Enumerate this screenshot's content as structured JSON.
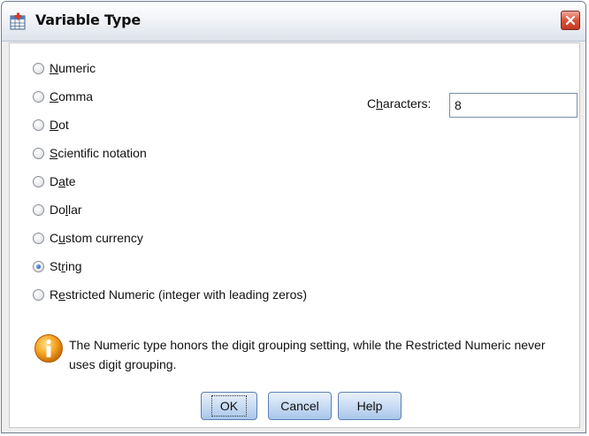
{
  "window": {
    "title": "Variable Type"
  },
  "format_options": [
    {
      "label_mn": "N",
      "label_rest": "umeric",
      "selected": false
    },
    {
      "label_mn": "C",
      "label_rest": "omma",
      "selected": false
    },
    {
      "label_mn": "D",
      "label_rest": "ot",
      "selected": false
    },
    {
      "label_mn": "S",
      "label_rest": "cientific notation",
      "selected": false
    },
    {
      "label_pre": "D",
      "label_mn": "a",
      "label_rest": "te",
      "selected": false
    },
    {
      "label_pre": "Do",
      "label_mn": "l",
      "label_rest": "lar",
      "selected": false
    },
    {
      "label_pre": "C",
      "label_mn": "u",
      "label_rest": "stom currency",
      "selected": false
    },
    {
      "label_pre": "St",
      "label_mn": "r",
      "label_rest": "ing",
      "selected": true
    },
    {
      "label_pre": "R",
      "label_mn": "e",
      "label_rest": "stricted Numeric (integer with leading zeros)",
      "selected": false
    }
  ],
  "characters": {
    "label_pre": "C",
    "label_mn": "h",
    "label_rest": "aracters:",
    "value": "8"
  },
  "info": {
    "icon": "info-icon",
    "text": "The Numeric type honors the digit grouping setting, while the Restricted Numeric never uses digit grouping."
  },
  "buttons": {
    "ok": "OK",
    "cancel": "Cancel",
    "help": "Help"
  },
  "colors": {
    "selected_radio": "#2c63c8",
    "close_button": "#d9533b",
    "button_face": "#c9dcf3"
  }
}
